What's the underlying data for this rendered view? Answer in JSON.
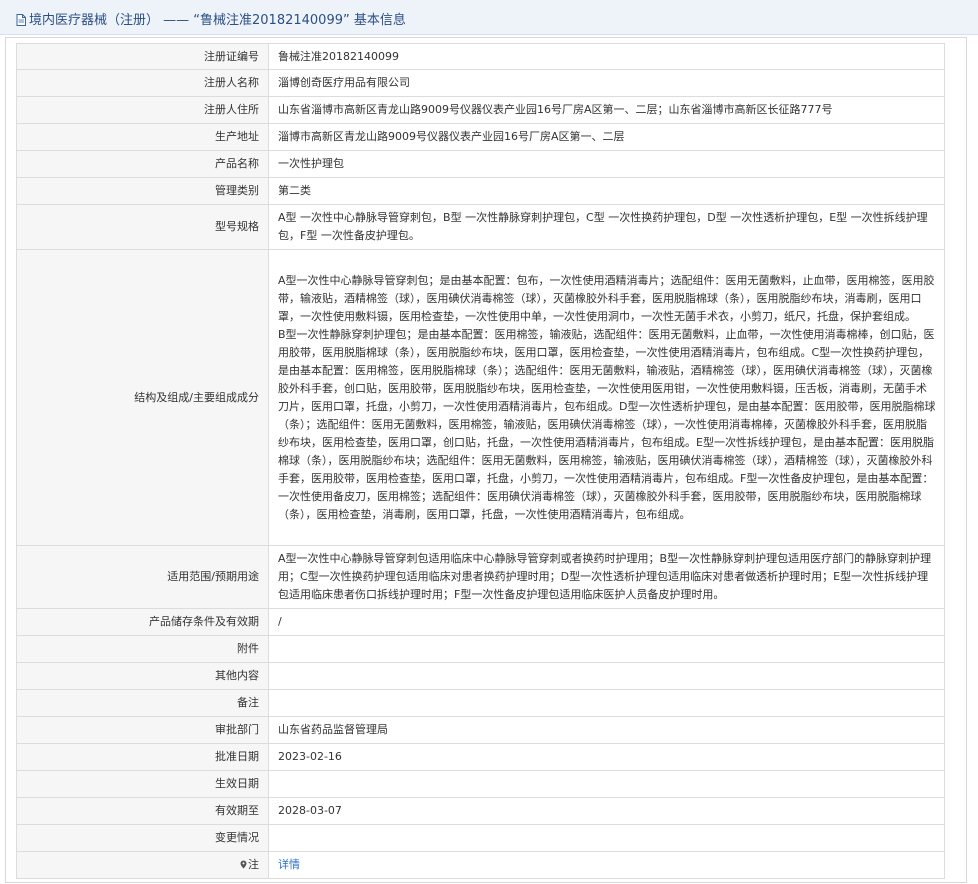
{
  "header": {
    "title": "境内医疗器械（注册） —— “鲁械注准20182140099” 基本信息"
  },
  "rows": [
    {
      "label": "注册证编号",
      "value": "鲁械注准20182140099"
    },
    {
      "label": "注册人名称",
      "value": "淄博创奇医疗用品有限公司"
    },
    {
      "label": "注册人住所",
      "value": "山东省淄博市高新区青龙山路9009号仪器仪表产业园16号厂房A区第一、二层；山东省淄博市高新区长征路777号"
    },
    {
      "label": "生产地址",
      "value": "淄博市高新区青龙山路9009号仪器仪表产业园16号厂房A区第一、二层"
    },
    {
      "label": "产品名称",
      "value": "一次性护理包"
    },
    {
      "label": "管理类别",
      "value": "第二类"
    },
    {
      "label": "型号规格",
      "value": "A型 一次性中心静脉导管穿刺包，B型 一次性静脉穿刺护理包，C型 一次性换药护理包，D型 一次性透析护理包，E型 一次性拆线护理包，F型 一次性备皮护理包。"
    },
    {
      "label": "结构及组成/主要组成成分",
      "value_p1": "A型一次性中心静脉导管穿刺包；是由基本配置：包布，一次性使用酒精消毒片；选配组件：医用无菌敷料，止血带，医用棉签，医用胶带，输液贴，酒精棉签（球），医用碘伏消毒棉签（球），灭菌橡胶外科手套，医用脱脂棉球（条），医用脱脂纱布块，消毒刷，医用口罩，一次性使用敷料镊，医用检查垫，一次性使用中单，一次性使用洞巾，一次性无菌手术衣，小剪刀，纸尺，托盘，保护套组成。",
      "value_p2": "B型一次性静脉穿刺护理包；是由基本配置：医用棉签，输液贴，选配组件：医用无菌敷料，止血带，一次性使用消毒棉棒，创口贴，医用胶带，医用脱脂棉球（条），医用脱脂纱布块，医用口罩，医用检查垫，一次性使用酒精消毒片，包布组成。C型一次性换药护理包，是由基本配置：医用棉签，医用脱脂棉球（条）；选配组件：医用无菌敷料，输液贴，酒精棉签（球），医用碘伏消毒棉签（球），灭菌橡胶外科手套，创口贴，医用胶带，医用脱脂纱布块，医用检查垫，一次性使用医用钳，一次性使用敷料镊，压舌板，消毒刷，无菌手术刀片，医用口罩，托盘，小剪刀，一次性使用酒精消毒片，包布组成。D型一次性透析护理包，是由基本配置：医用胶带，医用脱脂棉球（条）；选配组件：医用无菌敷料，医用棉签，输液贴，医用碘伏消毒棉签（球），一次性使用消毒棉棒，灭菌橡胶外科手套，医用脱脂纱布块，医用检查垫，医用口罩，创口贴，托盘，一次性使用酒精消毒片，包布组成。E型一次性拆线护理包，是由基本配置：医用脱脂棉球（条），医用脱脂纱布块；选配组件：医用无菌敷料，医用棉签，输液贴，医用碘伏消毒棉签（球），酒精棉签（球），灭菌橡胶外科手套，医用胶带，医用检查垫，医用口罩，托盘，小剪刀，一次性使用酒精消毒片，包布组成。F型一次性备皮护理包，是由基本配置：一次性使用备皮刀，医用棉签；选配组件：医用碘伏消毒棉签（球），灭菌橡胶外科手套，医用胶带，医用脱脂纱布块，医用脱脂棉球（条），医用检查垫，消毒刷，医用口罩，托盘，一次性使用酒精消毒片，包布组成。"
    },
    {
      "label": "适用范围/预期用途",
      "value": "A型一次性中心静脉导管穿刺包适用临床中心静脉导管穿刺或者换药时护理用；B型一次性静脉穿刺护理包适用医疗部门的静脉穿刺护理用；C型一次性换药护理包适用临床对患者换药护理时用；D型一次性透析护理包适用临床对患者做透析护理时用；E型一次性拆线护理包适用临床患者伤口拆线护理时用；F型一次性备皮护理包适用临床医护人员备皮护理时用。"
    },
    {
      "label": "产品储存条件及有效期",
      "value": "/"
    },
    {
      "label": "附件",
      "value": ""
    },
    {
      "label": "其他内容",
      "value": ""
    },
    {
      "label": "备注",
      "value": ""
    },
    {
      "label": "审批部门",
      "value": "山东省药品监督管理局"
    },
    {
      "label": "批准日期",
      "value": "2023-02-16"
    },
    {
      "label": "生效日期",
      "value": ""
    },
    {
      "label": "有效期至",
      "value": "2028-03-07"
    },
    {
      "label": "变更情况",
      "value": ""
    },
    {
      "label": "注",
      "value": "详情"
    }
  ],
  "colors": {
    "header_bg": "#eef3fa",
    "header_text": "#2b4f86",
    "label_bg": "#f6f6f6",
    "link": "#2a6fc9",
    "border": "#dcdcdc"
  },
  "icons": {
    "header": "document-icon",
    "note": "location-pin-icon"
  }
}
